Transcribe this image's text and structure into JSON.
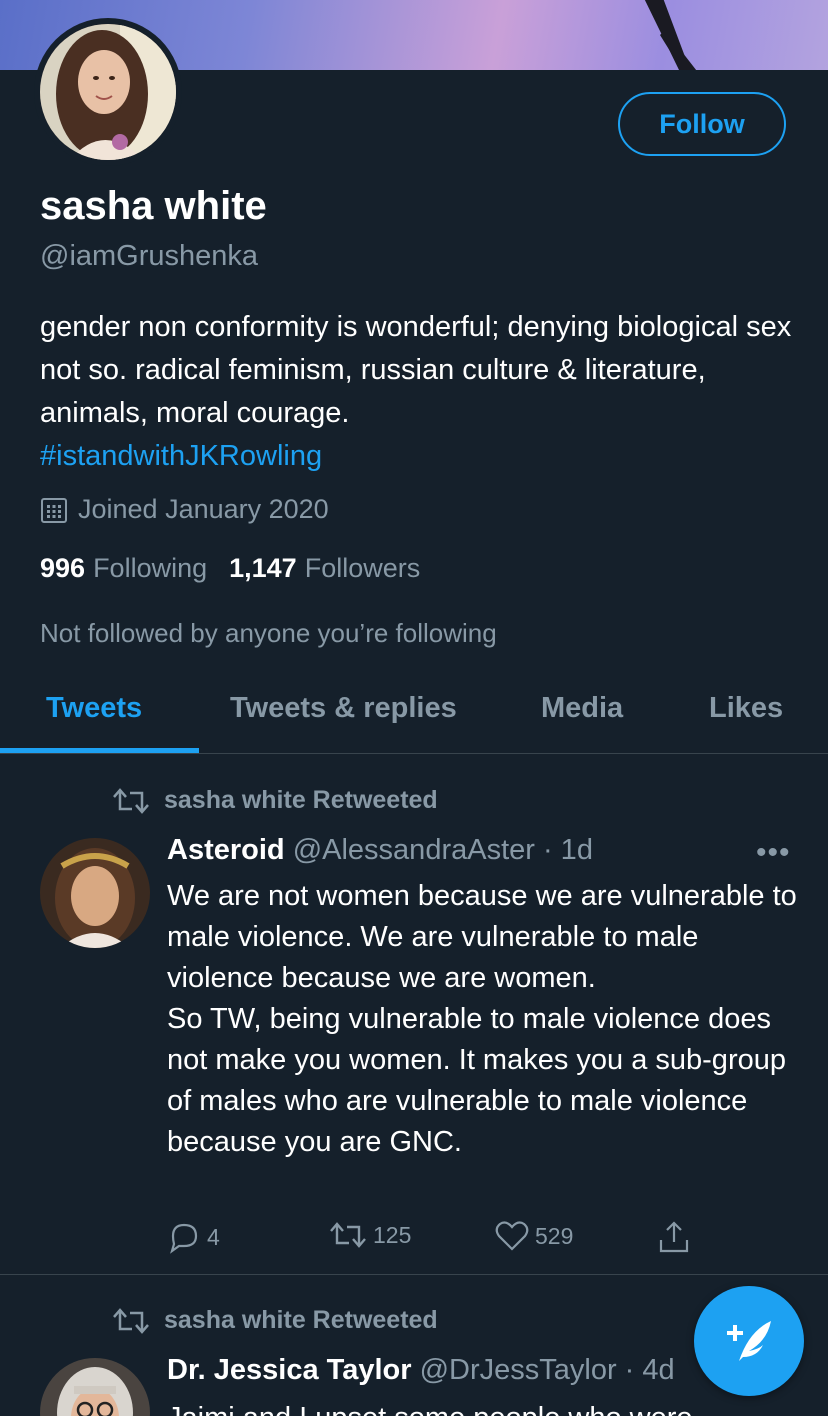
{
  "profile": {
    "name": "sasha white",
    "handle": "@iamGrushenka",
    "follow_label": "Follow",
    "bio_text": "gender non conformity is wonderful; denying biological sex not so. radical feminism, russian culture & literature, animals, moral courage.",
    "bio_hashtag": "#istandwithJKRowling",
    "joined": "Joined January 2020",
    "following_count": "996",
    "following_label": "Following",
    "followers_count": "1,147",
    "followers_label": "Followers",
    "not_followed_note": "Not followed by anyone you’re following"
  },
  "tabs": [
    {
      "label": "Tweets",
      "active": true
    },
    {
      "label": "Tweets & replies",
      "active": false
    },
    {
      "label": "Media",
      "active": false
    },
    {
      "label": "Likes",
      "active": false
    }
  ],
  "tweets": [
    {
      "retweet_note": "sasha white Retweeted",
      "author": "Asteroid",
      "meta": "@AlessandraAster · 1d",
      "more": "•••",
      "body": "We are not women because we are vulnerable to male violence. We are vulnerable to male violence because we are women.\nSo TW, being vulnerable to male violence does not make you women. It makes you a sub-group of males who are vulnerable to male violence because you are GNC.",
      "replies": "4",
      "retweets": "125",
      "likes": "529"
    },
    {
      "retweet_note": "sasha white Retweeted",
      "author": "Dr. Jessica Taylor",
      "meta": "@DrJessTaylor · 4d",
      "body": "Jaimi and I upset some people who were"
    }
  ],
  "colors": {
    "background": "#15202b",
    "accent": "#1da1f2",
    "secondary_text": "#8899a6",
    "divider": "#38444d"
  },
  "icons": {
    "calendar": "calendar-icon",
    "retweet": "retweet-icon",
    "reply": "reply-icon",
    "like": "heart-icon",
    "share": "share-icon",
    "compose": "compose-tweet-icon"
  }
}
